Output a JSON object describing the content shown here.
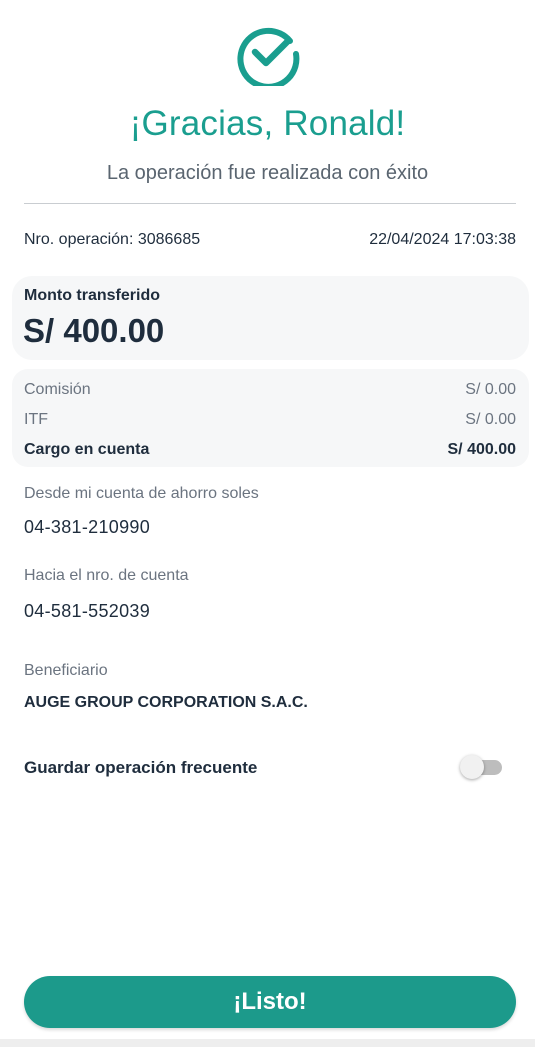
{
  "colors": {
    "accent": "#1a9e8f",
    "button": "#1c9a8b",
    "card": "#f6f7f8"
  },
  "icons": {
    "success": "check-circle-icon"
  },
  "header": {
    "title": "¡Gracias, Ronald!",
    "subtitle": "La operación fue realizada con éxito"
  },
  "operation": {
    "number_label": "Nro. operación: 3086685",
    "datetime": "22/04/2024 17:03:38"
  },
  "amount": {
    "label": "Monto transferido",
    "value": "S/ 400.00"
  },
  "fees": [
    {
      "label": "Comisión",
      "value": "S/ 0.00"
    },
    {
      "label": "ITF",
      "value": "S/ 0.00"
    },
    {
      "label": "Cargo en cuenta",
      "value": "S/ 400.00"
    }
  ],
  "from_account": {
    "label": "Desde mi cuenta de ahorro soles",
    "value": "04-381-210990"
  },
  "to_account": {
    "label": "Hacia el nro. de cuenta",
    "value": "04-581-552039"
  },
  "beneficiary": {
    "label": "Beneficiario",
    "value": "AUGE GROUP CORPORATION S.A.C."
  },
  "save_frequent": {
    "label": "Guardar operación frecuente",
    "enabled": false
  },
  "done_button": {
    "label": "¡Listo!"
  }
}
